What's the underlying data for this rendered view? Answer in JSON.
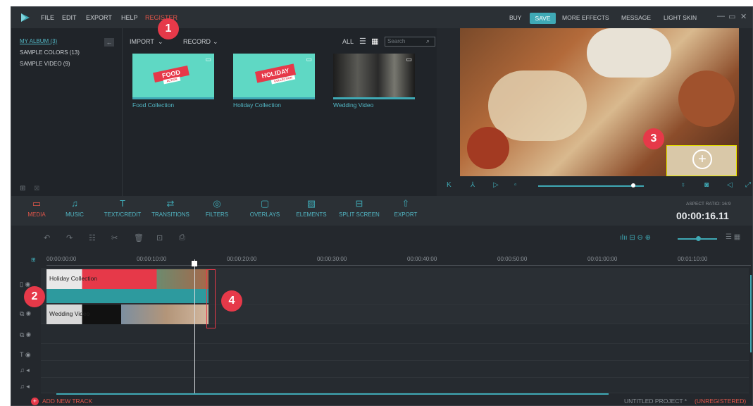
{
  "menu": {
    "file": "FILE",
    "edit": "EDIT",
    "export": "EXPORT",
    "help": "HELP",
    "register": "REGISTER"
  },
  "topright": {
    "buy": "BUY",
    "save": "SAVE",
    "more_effects": "MORE EFFECTS",
    "message": "MESSAGE",
    "light_skin": "LIGHT SKIN"
  },
  "library": {
    "albums": [
      "MY ALBUM (3)",
      "SAMPLE COLORS (13)",
      "SAMPLE VIDEO (9)"
    ],
    "import": "IMPORT",
    "record": "RECORD",
    "all": "ALL",
    "search_placeholder": "Search",
    "media": [
      {
        "label": "Food Collection",
        "tag": "FOOD",
        "sub": "ACTION"
      },
      {
        "label": "Holiday Collection",
        "tag": "HOLIDAY",
        "sub": "COLLECTION"
      },
      {
        "label": "Wedding Video"
      }
    ]
  },
  "tools": {
    "media": "MEDIA",
    "music": "MUSIC",
    "text_credit": "TEXT/CREDIT",
    "transitions": "TRANSITIONS",
    "filters": "FILTERS",
    "overlays": "OVERLAYS",
    "elements": "ELEMENTS",
    "split_screen": "SPLIT SCREEN",
    "export": "EXPORT"
  },
  "aspect": {
    "label": "ASPECT RATIO: 16:9",
    "time": "00:00:16.11"
  },
  "ruler": [
    "00:00:00:00",
    "00:00:10:00",
    "00:00:20:00",
    "00:00:30:00",
    "00:00:40:00",
    "00:00:50:00",
    "00:01:00:00",
    "00:01:10:00"
  ],
  "clips": {
    "video1": "Holiday Collection",
    "video2": "Wedding Video"
  },
  "footer": {
    "add_track": "ADD NEW TRACK",
    "project": "UNTITLED PROJECT *",
    "unregistered": "(UNREGISTERED)"
  },
  "callouts": [
    "1",
    "2",
    "3",
    "4"
  ],
  "colors": {
    "accent": "#3fa9b5",
    "red": "#e63949",
    "background": "#24282d"
  },
  "preview": {
    "playback_progress": 0.9
  }
}
